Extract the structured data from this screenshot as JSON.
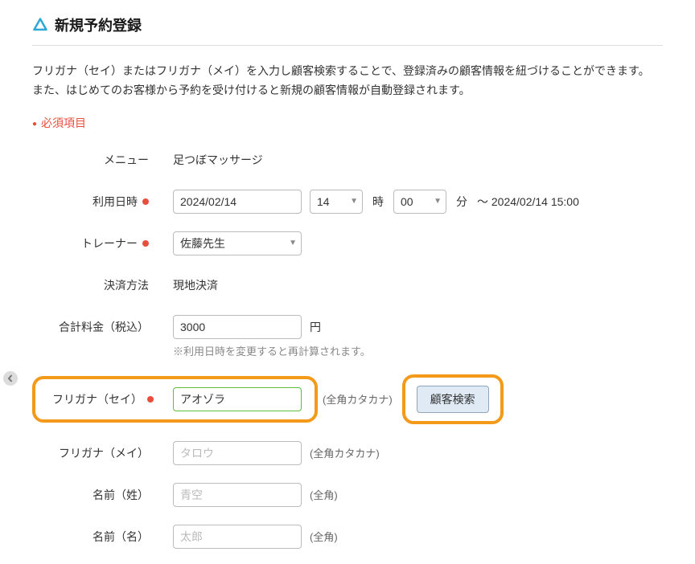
{
  "header": {
    "title": "新規予約登録"
  },
  "intro": {
    "line1": "フリガナ（セイ）またはフリガナ（メイ）を入力し顧客検索することで、登録済みの顧客情報を紐づけることができます。",
    "line2": "また、はじめてのお客様から予約を受け付けると新規の顧客情報が自動登録されます。"
  },
  "required_legend": "必須項目",
  "labels": {
    "menu": "メニュー",
    "datetime": "利用日時",
    "trainer": "トレーナー",
    "payment": "決済方法",
    "total": "合計料金（税込）",
    "furigana_sei": "フリガナ（セイ）",
    "furigana_mei": "フリガナ（メイ）",
    "name_sei": "名前（姓）",
    "name_mei": "名前（名）"
  },
  "values": {
    "menu": "足つぼマッサージ",
    "date": "2024/02/14",
    "hour": "14",
    "minute": "00",
    "end_text": "～ 2024/02/14 15:00",
    "trainer": "佐藤先生",
    "payment": "現地決済",
    "total": "3000",
    "furigana_sei": "アオゾラ",
    "furigana_mei": "",
    "name_sei": "",
    "name_mei": ""
  },
  "units": {
    "hour_sep": "時",
    "minute_sep": "分",
    "yen": "円"
  },
  "notes": {
    "total_hint": "※利用日時を変更すると再計算されます。",
    "zenkaku_katakana": "(全角カタカナ)",
    "zenkaku": "(全角)"
  },
  "placeholders": {
    "furigana_mei": "タロウ",
    "name_sei": "青空",
    "name_mei": "太郎"
  },
  "buttons": {
    "customer_search": "顧客検索"
  }
}
